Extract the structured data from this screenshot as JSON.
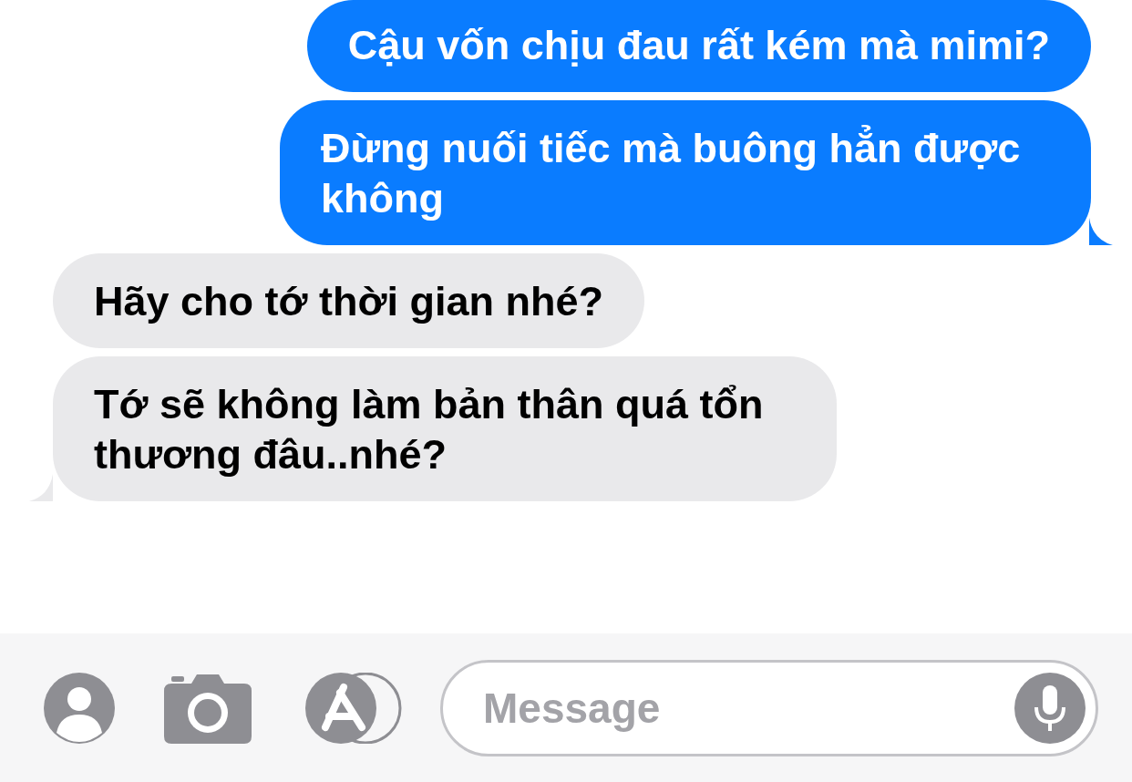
{
  "messages": [
    {
      "kind": "sent",
      "text": "Cậu vốn chịu đau rất kém mà mimi?",
      "tail": false
    },
    {
      "kind": "sent",
      "text": "Đừng nuối tiếc mà buông hẳn được không",
      "tail": true
    },
    {
      "kind": "received",
      "text": "Hãy cho tớ thời gian nhé?",
      "tail": false
    },
    {
      "kind": "received",
      "text": "Tớ sẽ không làm bản thân quá tổn thương đâu..nhé?",
      "tail": true
    }
  ],
  "composer": {
    "placeholder": "Message"
  }
}
